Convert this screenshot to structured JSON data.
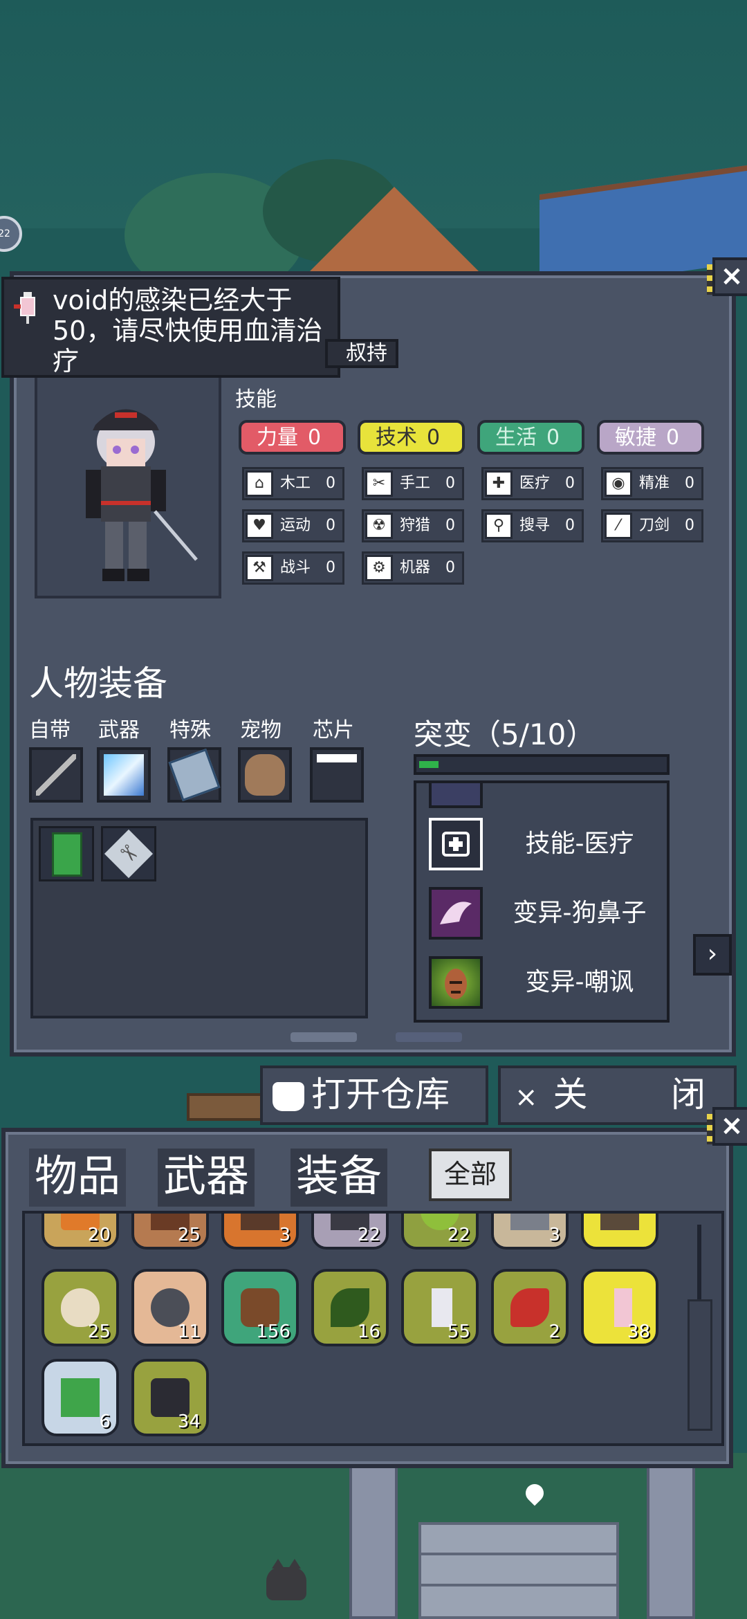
{
  "notification": {
    "text": "void的感染已经大于50，请尽快使用血清治疗"
  },
  "character": {
    "hold_tag": "叔持",
    "skills_title": "技能",
    "attributes": [
      {
        "label": "力量",
        "value": "0"
      },
      {
        "label": "技术",
        "value": "0"
      },
      {
        "label": "生活",
        "value": "0"
      },
      {
        "label": "敏捷",
        "value": "0"
      }
    ],
    "skills": [
      {
        "label": "木工",
        "value": "0",
        "icon": "house-icon"
      },
      {
        "label": "手工",
        "value": "0",
        "icon": "scissors-icon"
      },
      {
        "label": "医疗",
        "value": "0",
        "icon": "medkit-icon"
      },
      {
        "label": "精准",
        "value": "0",
        "icon": "eye-icon"
      },
      {
        "label": "运动",
        "value": "0",
        "icon": "heart-icon"
      },
      {
        "label": "狩猎",
        "value": "0",
        "icon": "radiation-icon"
      },
      {
        "label": "搜寻",
        "value": "0",
        "icon": "magnifier-icon"
      },
      {
        "label": "刀剑",
        "value": "0",
        "icon": "blade-icon"
      },
      {
        "label": "战斗",
        "value": "0",
        "icon": "hammer-icon"
      },
      {
        "label": "机器",
        "value": "0",
        "icon": "gear-icon"
      }
    ],
    "equip_title": "人物装备",
    "slot_labels": [
      "自带",
      "武器",
      "特殊",
      "宠物",
      "芯片"
    ],
    "mutation": {
      "title": "突变（5/10）",
      "progress": 0.08,
      "items": [
        {
          "label": "技能-医疗",
          "icon": "medkit-icon"
        },
        {
          "label": "变异-狗鼻子",
          "icon": "dog-nose-icon"
        },
        {
          "label": "变异-嘲讽",
          "icon": "taunt-face-icon"
        }
      ]
    }
  },
  "buttons": {
    "open_storage": "打开仓库",
    "close_x": "×",
    "close_1": "关",
    "close_2": "闭"
  },
  "inventory": {
    "tabs": [
      "物品",
      "武器",
      "装备"
    ],
    "filter": "全部",
    "row_top": [
      "20",
      "25",
      "3",
      "22",
      "22",
      "3",
      ""
    ],
    "row_mid": [
      "25",
      "11",
      "156",
      "16",
      "55",
      "2",
      "38"
    ],
    "row_bot": [
      "6",
      "34"
    ]
  }
}
